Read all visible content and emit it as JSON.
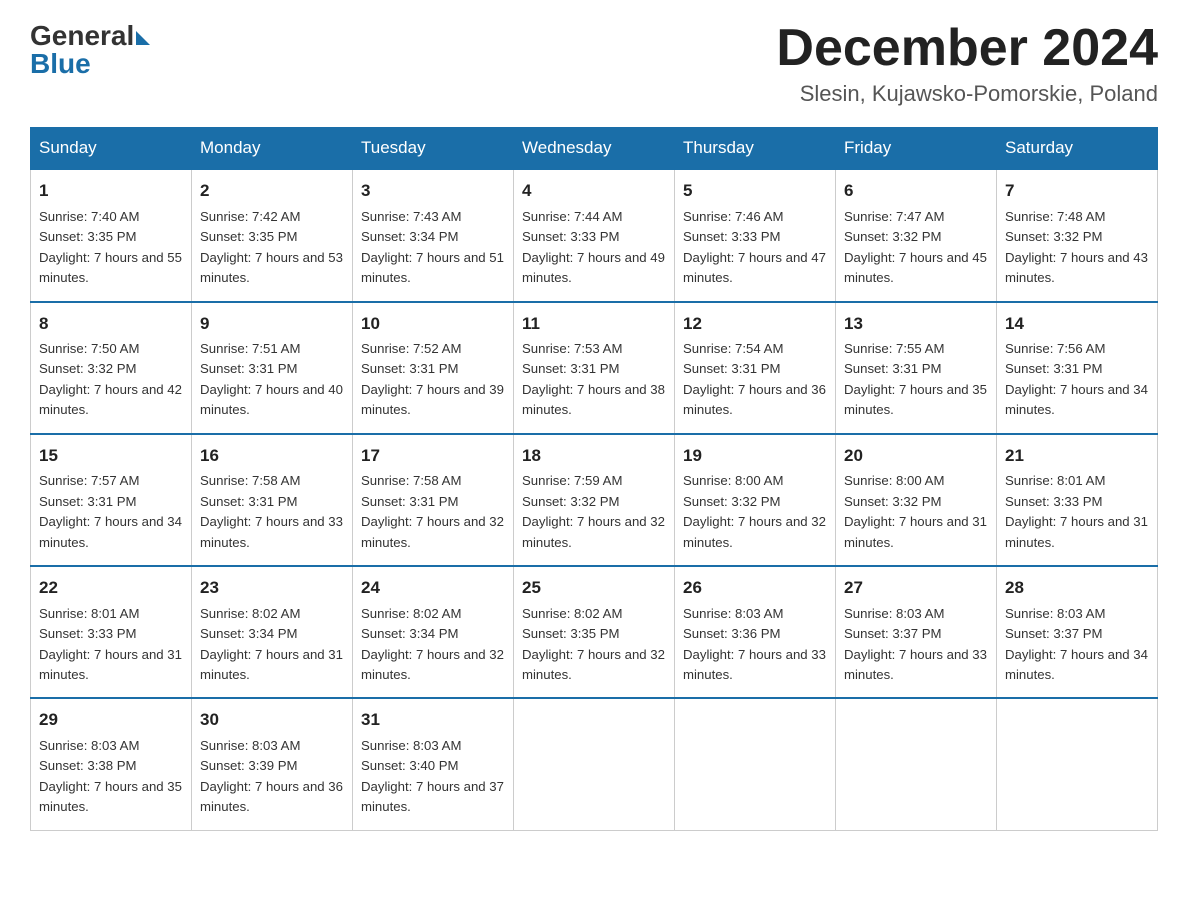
{
  "header": {
    "logo_general": "General",
    "logo_blue": "Blue",
    "month_title": "December 2024",
    "location": "Slesin, Kujawsko-Pomorskie, Poland"
  },
  "days_of_week": [
    "Sunday",
    "Monday",
    "Tuesday",
    "Wednesday",
    "Thursday",
    "Friday",
    "Saturday"
  ],
  "weeks": [
    [
      {
        "day": "1",
        "sunrise": "7:40 AM",
        "sunset": "3:35 PM",
        "daylight": "7 hours and 55 minutes."
      },
      {
        "day": "2",
        "sunrise": "7:42 AM",
        "sunset": "3:35 PM",
        "daylight": "7 hours and 53 minutes."
      },
      {
        "day": "3",
        "sunrise": "7:43 AM",
        "sunset": "3:34 PM",
        "daylight": "7 hours and 51 minutes."
      },
      {
        "day": "4",
        "sunrise": "7:44 AM",
        "sunset": "3:33 PM",
        "daylight": "7 hours and 49 minutes."
      },
      {
        "day": "5",
        "sunrise": "7:46 AM",
        "sunset": "3:33 PM",
        "daylight": "7 hours and 47 minutes."
      },
      {
        "day": "6",
        "sunrise": "7:47 AM",
        "sunset": "3:32 PM",
        "daylight": "7 hours and 45 minutes."
      },
      {
        "day": "7",
        "sunrise": "7:48 AM",
        "sunset": "3:32 PM",
        "daylight": "7 hours and 43 minutes."
      }
    ],
    [
      {
        "day": "8",
        "sunrise": "7:50 AM",
        "sunset": "3:32 PM",
        "daylight": "7 hours and 42 minutes."
      },
      {
        "day": "9",
        "sunrise": "7:51 AM",
        "sunset": "3:31 PM",
        "daylight": "7 hours and 40 minutes."
      },
      {
        "day": "10",
        "sunrise": "7:52 AM",
        "sunset": "3:31 PM",
        "daylight": "7 hours and 39 minutes."
      },
      {
        "day": "11",
        "sunrise": "7:53 AM",
        "sunset": "3:31 PM",
        "daylight": "7 hours and 38 minutes."
      },
      {
        "day": "12",
        "sunrise": "7:54 AM",
        "sunset": "3:31 PM",
        "daylight": "7 hours and 36 minutes."
      },
      {
        "day": "13",
        "sunrise": "7:55 AM",
        "sunset": "3:31 PM",
        "daylight": "7 hours and 35 minutes."
      },
      {
        "day": "14",
        "sunrise": "7:56 AM",
        "sunset": "3:31 PM",
        "daylight": "7 hours and 34 minutes."
      }
    ],
    [
      {
        "day": "15",
        "sunrise": "7:57 AM",
        "sunset": "3:31 PM",
        "daylight": "7 hours and 34 minutes."
      },
      {
        "day": "16",
        "sunrise": "7:58 AM",
        "sunset": "3:31 PM",
        "daylight": "7 hours and 33 minutes."
      },
      {
        "day": "17",
        "sunrise": "7:58 AM",
        "sunset": "3:31 PM",
        "daylight": "7 hours and 32 minutes."
      },
      {
        "day": "18",
        "sunrise": "7:59 AM",
        "sunset": "3:32 PM",
        "daylight": "7 hours and 32 minutes."
      },
      {
        "day": "19",
        "sunrise": "8:00 AM",
        "sunset": "3:32 PM",
        "daylight": "7 hours and 32 minutes."
      },
      {
        "day": "20",
        "sunrise": "8:00 AM",
        "sunset": "3:32 PM",
        "daylight": "7 hours and 31 minutes."
      },
      {
        "day": "21",
        "sunrise": "8:01 AM",
        "sunset": "3:33 PM",
        "daylight": "7 hours and 31 minutes."
      }
    ],
    [
      {
        "day": "22",
        "sunrise": "8:01 AM",
        "sunset": "3:33 PM",
        "daylight": "7 hours and 31 minutes."
      },
      {
        "day": "23",
        "sunrise": "8:02 AM",
        "sunset": "3:34 PM",
        "daylight": "7 hours and 31 minutes."
      },
      {
        "day": "24",
        "sunrise": "8:02 AM",
        "sunset": "3:34 PM",
        "daylight": "7 hours and 32 minutes."
      },
      {
        "day": "25",
        "sunrise": "8:02 AM",
        "sunset": "3:35 PM",
        "daylight": "7 hours and 32 minutes."
      },
      {
        "day": "26",
        "sunrise": "8:03 AM",
        "sunset": "3:36 PM",
        "daylight": "7 hours and 33 minutes."
      },
      {
        "day": "27",
        "sunrise": "8:03 AM",
        "sunset": "3:37 PM",
        "daylight": "7 hours and 33 minutes."
      },
      {
        "day": "28",
        "sunrise": "8:03 AM",
        "sunset": "3:37 PM",
        "daylight": "7 hours and 34 minutes."
      }
    ],
    [
      {
        "day": "29",
        "sunrise": "8:03 AM",
        "sunset": "3:38 PM",
        "daylight": "7 hours and 35 minutes."
      },
      {
        "day": "30",
        "sunrise": "8:03 AM",
        "sunset": "3:39 PM",
        "daylight": "7 hours and 36 minutes."
      },
      {
        "day": "31",
        "sunrise": "8:03 AM",
        "sunset": "3:40 PM",
        "daylight": "7 hours and 37 minutes."
      },
      null,
      null,
      null,
      null
    ]
  ]
}
